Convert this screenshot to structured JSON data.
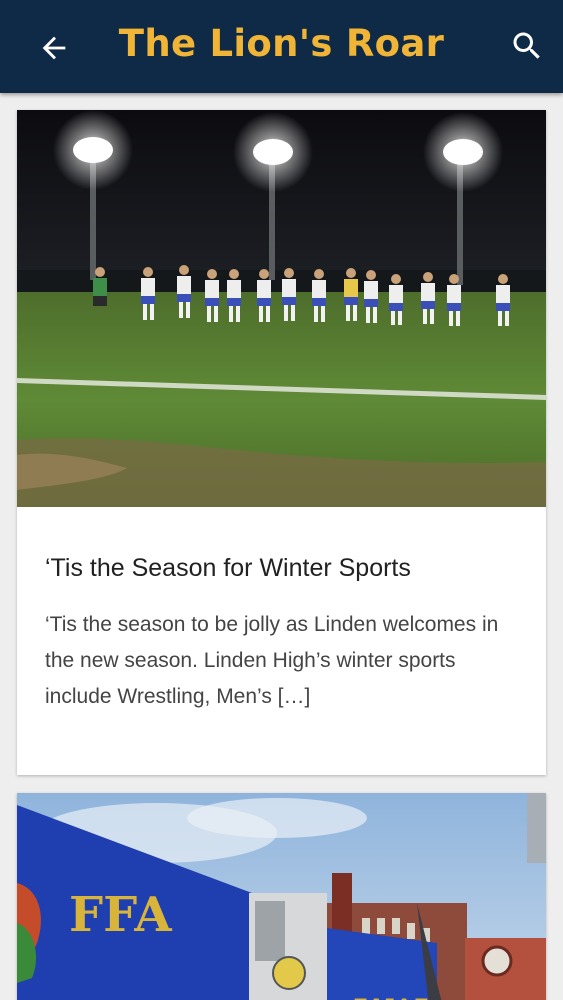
{
  "app_bar": {
    "title": "The Lion's Roar",
    "back_icon": "arrow-left-icon",
    "search_icon": "search-icon",
    "background": "#0e2a47",
    "title_color": "#f0b537"
  },
  "articles": [
    {
      "title": "‘Tis the Season for Winter Sports",
      "excerpt": "‘Tis the season to be jolly as Linden welcomes in the new season. Linden High’s winter sports include Wrestling, Men’s […]",
      "image": "night soccer field with players"
    },
    {
      "image_sign_text": "FFA",
      "image_banner_text": "WAY",
      "image": "blue FFA trailer in front of brick buildings"
    }
  ]
}
